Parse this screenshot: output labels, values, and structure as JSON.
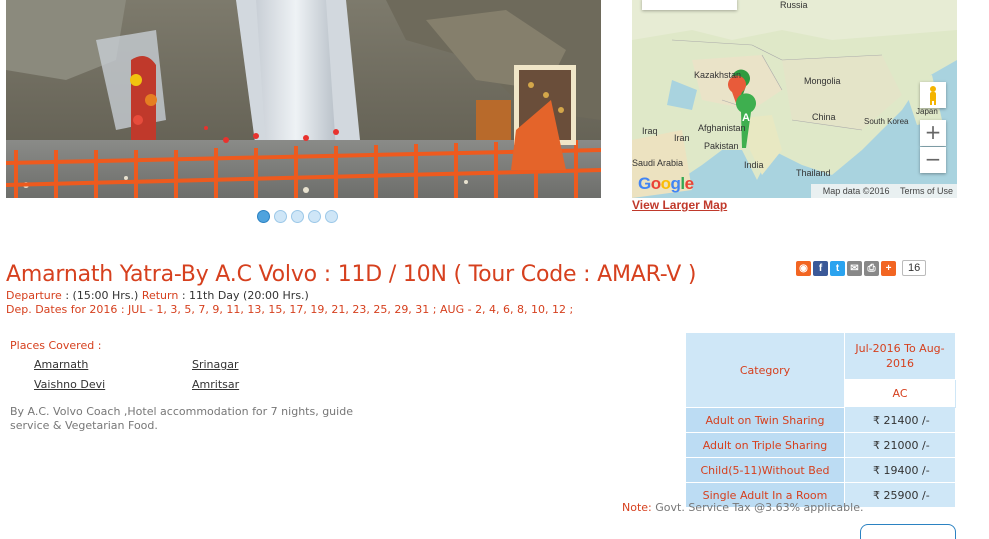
{
  "map": {
    "labels": {
      "russia": "Russia",
      "kazakhstan": "Kazakhstan",
      "mongolia": "Mongolia",
      "china": "China",
      "japan": "Japan",
      "south_korea": "South Korea",
      "iraq": "Iraq",
      "iran": "Iran",
      "afghanistan": "Afghanistan",
      "pakistan": "Pakistan",
      "india": "India",
      "thailand": "Thailand",
      "saudi_arabia": "Saudi Arabia"
    },
    "marker_label": "A",
    "google_logo": "Google",
    "data_text": "Map data ©2016",
    "terms_text": "Terms of Use",
    "zoom_in": "+",
    "zoom_out": "−",
    "larger_map_link": "View Larger Map"
  },
  "slider": {
    "dot_count": 5,
    "active_index": 0
  },
  "tour": {
    "title": "Amarnath Yatra-By A.C Volvo : 11D / 10N ( Tour Code : AMAR-V )",
    "departure_label": "Departure",
    "departure_value": " : (15:00 Hrs.) ",
    "return_label": "Return",
    "return_value": " : 11th Day (20:00 Hrs.)",
    "dep_dates": "Dep. Dates for 2016 : JUL - 1, 3, 5, 7, 9, 11, 13, 15, 17, 19, 21, 23, 25, 29, 31 ; AUG - 2, 4, 6, 8, 10, 12 ;"
  },
  "share": {
    "icons": [
      {
        "name": "rss-icon",
        "glyph": "◉",
        "color": "#f26522"
      },
      {
        "name": "facebook-icon",
        "glyph": "f",
        "color": "#3b5998"
      },
      {
        "name": "twitter-icon",
        "glyph": "t",
        "color": "#2aa3ef"
      },
      {
        "name": "email-icon",
        "glyph": "✉",
        "color": "#888888"
      },
      {
        "name": "print-icon",
        "glyph": "⎙",
        "color": "#888888"
      },
      {
        "name": "plus-icon",
        "glyph": "+",
        "color": "#f26522"
      }
    ],
    "count": "16"
  },
  "places": {
    "heading": "Places Covered :",
    "items": [
      "Amarnath",
      "Srinagar",
      "Vaishno Devi",
      "Amritsar"
    ]
  },
  "description": "By A.C. Volvo Coach ,Hotel accommodation for 7 nights, guide service & Vegetarian Food.",
  "pricing": {
    "category_header": "Category",
    "period_header": "Jul-2016 To Aug-2016",
    "class_header": "AC",
    "rows": [
      {
        "category": "Adult on Twin Sharing",
        "price": "₹ 21400 /-"
      },
      {
        "category": "Adult on Triple Sharing",
        "price": "₹ 21000 /-"
      },
      {
        "category": "Child(5-11)Without Bed",
        "price": "₹ 19400 /-"
      },
      {
        "category": "Single Adult In a Room",
        "price": "₹ 25900 /-"
      }
    ]
  },
  "note": {
    "label": "Note:",
    "text": " Govt. Service Tax @3.63% applicable."
  },
  "colors": {
    "accent": "#d6401e",
    "table_border": "#c0392b",
    "table_fill": "#cfe7f7",
    "link_blue": "#2b82c2"
  }
}
